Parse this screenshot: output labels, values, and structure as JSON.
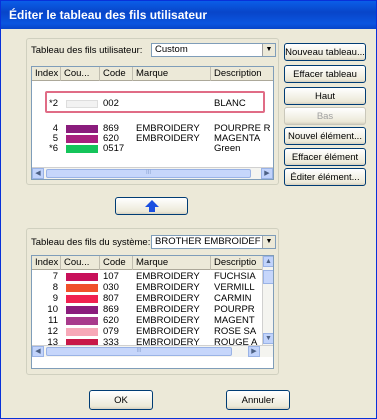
{
  "window": {
    "title": "Éditer le tableau des fils utilisateur"
  },
  "user_table": {
    "label": "Tableau des fils utilisateur:",
    "combo_value": "Custom",
    "columns": [
      "Index",
      "Cou...",
      "Code",
      "Marque",
      "Description"
    ],
    "rows": [
      {
        "index": "",
        "color": "",
        "code": "",
        "brand": "",
        "description": ""
      },
      {
        "index": "*2",
        "color": "#f2f2f2",
        "code": "002",
        "brand": "",
        "description": "BLANC"
      },
      {
        "index": "",
        "color": "",
        "code": "",
        "brand": "",
        "description": ""
      },
      {
        "index": "4",
        "color": "#8a1c7c",
        "code": "869",
        "brand": "EMBROIDERY",
        "description": "POURPRE R"
      },
      {
        "index": "5",
        "color": "#a8207e",
        "code": "620",
        "brand": "EMBROIDERY",
        "description": "MAGENTA"
      },
      {
        "index": "*6",
        "color": "#14c45a",
        "code": "0517",
        "brand": "",
        "description": "Green"
      }
    ]
  },
  "buttons": {
    "new_table": "Nouveau tableau...",
    "clear_table": "Effacer tableau",
    "up": "Haut",
    "down": "Bas",
    "new_item": "Nouvel élément...",
    "delete_item": "Effacer élément",
    "edit_item": "Éditer élément...",
    "ok": "OK",
    "cancel": "Annuler"
  },
  "system_table": {
    "label": "Tableau des fils du système:",
    "combo_value": "BROTHER EMBROIDEF",
    "columns": [
      "Index",
      "Cou...",
      "Code",
      "Marque",
      "Descriptio"
    ],
    "rows": [
      {
        "index": "7",
        "color": "#c8105a",
        "code": "107",
        "brand": "EMBROIDERY",
        "description": "FUCHSIA"
      },
      {
        "index": "8",
        "color": "#f0502a",
        "code": "030",
        "brand": "EMBROIDERY",
        "description": "VERMILL"
      },
      {
        "index": "9",
        "color": "#f02050",
        "code": "807",
        "brand": "EMBROIDERY",
        "description": "CARMIN"
      },
      {
        "index": "10",
        "color": "#8a1c7c",
        "code": "869",
        "brand": "EMBROIDERY",
        "description": "POURPR"
      },
      {
        "index": "11",
        "color": "#a83a8c",
        "code": "620",
        "brand": "EMBROIDERY",
        "description": "MAGENT"
      },
      {
        "index": "12",
        "color": "#f7a8b8",
        "code": "079",
        "brand": "EMBROIDERY",
        "description": "ROSE SA"
      },
      {
        "index": "13",
        "color": "#c81848",
        "code": "333",
        "brand": "EMBROIDERY",
        "description": "ROUGE A"
      }
    ]
  },
  "scroll_thumb_glyph": "III"
}
